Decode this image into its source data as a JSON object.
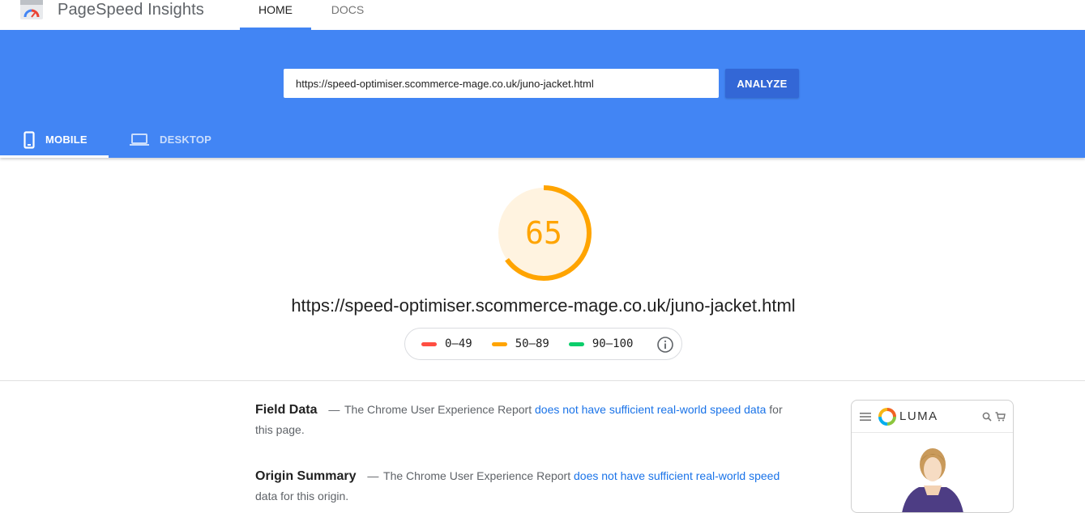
{
  "app": {
    "title": "PageSpeed Insights"
  },
  "nav": {
    "home": "HOME",
    "docs": "DOCS"
  },
  "search": {
    "url_value": "https://speed-optimiser.scommerce-mage.co.uk/juno-jacket.html",
    "analyze_label": "ANALYZE"
  },
  "device_tabs": {
    "mobile": "MOBILE",
    "desktop": "DESKTOP",
    "selected": "MOBILE"
  },
  "score": {
    "value": "65",
    "fraction": 0.65,
    "color": "#ffa400",
    "background": "#fff3e0"
  },
  "tested_url": "https://speed-optimiser.scommerce-mage.co.uk/juno-jacket.html",
  "legend": {
    "ranges": [
      {
        "label": "0–49",
        "color": "#ff4e42"
      },
      {
        "label": "50–89",
        "color": "#ffa400"
      },
      {
        "label": "90–100",
        "color": "#0cce6b"
      }
    ],
    "icon": "info-icon"
  },
  "field_data": {
    "heading": "Field Data",
    "dash": "—",
    "text_before": "The Chrome User Experience Report",
    "link": "does not have sufficient real-world speed data",
    "text_after": "for this page."
  },
  "origin_summary": {
    "heading": "Origin Summary",
    "dash": "—",
    "text_before": "The Chrome User Experience Report",
    "link": "does not have sufficient real-world speed",
    "text_after": "data for this origin."
  },
  "preview": {
    "brand": "LUMA",
    "icons": [
      "menu-icon",
      "luma-logo-icon",
      "search-icon",
      "cart-icon"
    ]
  },
  "colors": {
    "brand_blue": "#4285f4",
    "button_blue": "#3367d6",
    "link_blue": "#1a73e8"
  }
}
